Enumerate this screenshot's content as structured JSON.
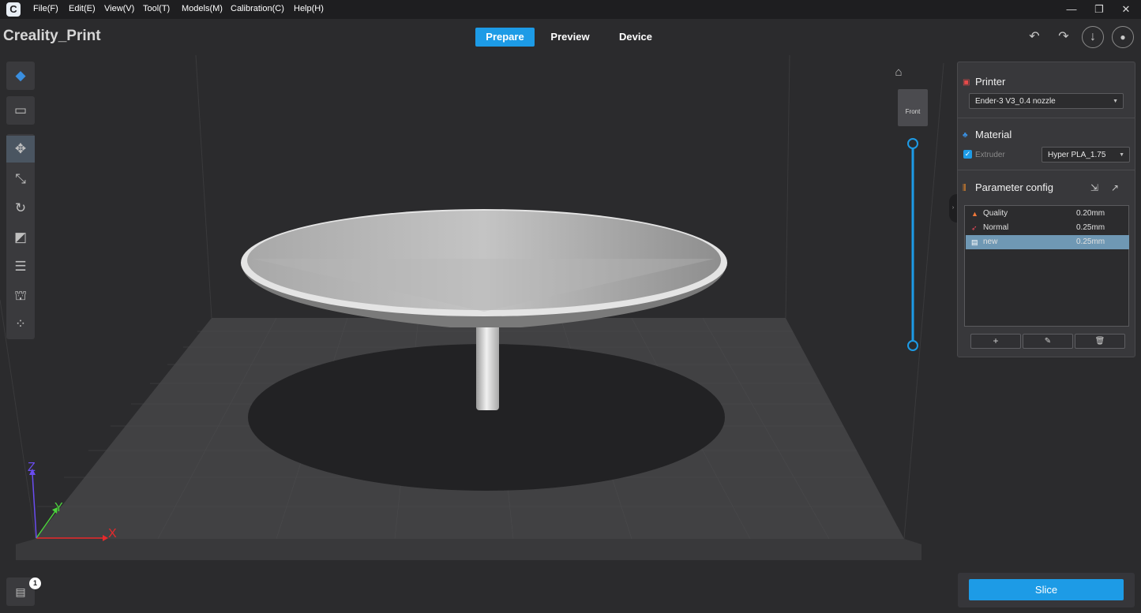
{
  "app": {
    "icon_letter": "C",
    "title": "Creality_Print"
  },
  "menu": [
    "File(F)",
    "Edit(E)",
    "View(V)",
    "Tool(T)",
    "Models(M)",
    "Calibration(C)",
    "Help(H)"
  ],
  "window_controls": {
    "minimize": "—",
    "restore": "❐",
    "close": "✕"
  },
  "tabs": [
    "Prepare",
    "Preview",
    "Device"
  ],
  "active_tab": "Prepare",
  "header_icons": {
    "undo": "↶",
    "redo": "↷",
    "download": "↓",
    "account": "●"
  },
  "viewport": {
    "view_cube_label": "Front",
    "axes": {
      "x": "X",
      "y": "Y",
      "z": "Z"
    },
    "axis_colors": {
      "x": "#e8292b",
      "y": "#4cd23c",
      "z": "#6a4cf0"
    },
    "layer_slider_color": "#1d9be6"
  },
  "toolbar_icons": [
    "cube-icon",
    "folder-icon",
    "move-icon",
    "scale-icon",
    "rotate-icon",
    "lay-flat-icon",
    "list-icon",
    "support-icon",
    "arrange-icon"
  ],
  "panel": {
    "printer": {
      "title": "Printer",
      "selected": "Ender-3 V3_0.4 nozzle"
    },
    "material": {
      "title": "Material",
      "extruder_label": "Extruder",
      "extruder_checked": true,
      "selected": "Hyper PLA_1.75"
    },
    "parameter_config": {
      "title": "Parameter config",
      "rows": [
        {
          "name": "Quality",
          "value": "0.20mm",
          "icon": "flame-icon"
        },
        {
          "name": "Normal",
          "value": "0.25mm",
          "icon": "rocket-icon"
        },
        {
          "name": "new",
          "value": "0.25mm",
          "icon": "doc-icon",
          "selected": true
        }
      ],
      "buttons": {
        "add": "+",
        "edit": "✎",
        "delete": "🗑"
      }
    }
  },
  "slice_label": "Slice",
  "file_list_badge": "1",
  "colors": {
    "accent": "#1d9be6",
    "background": "#2b2b2d",
    "menubar": "#1e1e20"
  }
}
